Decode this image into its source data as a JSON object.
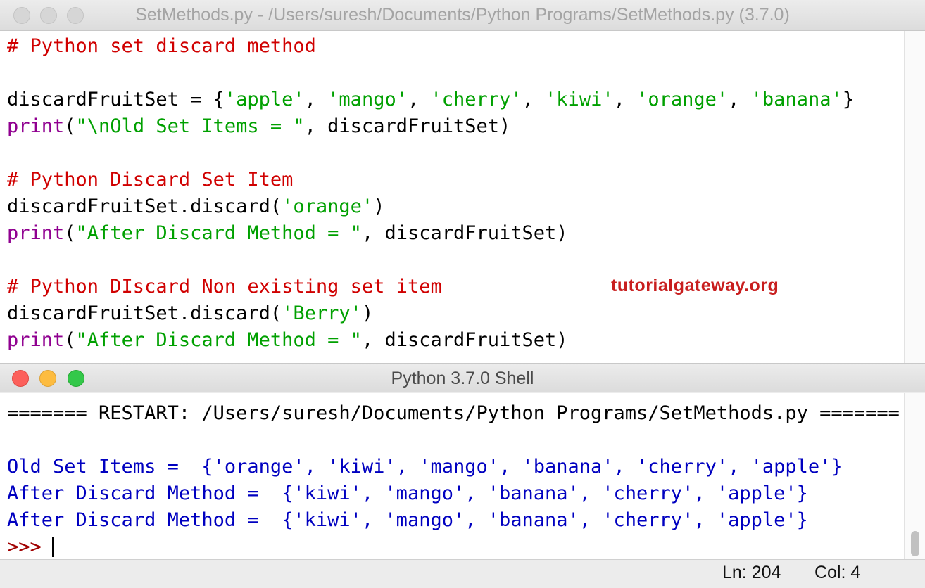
{
  "editor_window": {
    "title": "SetMethods.py - /Users/suresh/Documents/Python Programs/SetMethods.py (3.7.0)",
    "code_lines": [
      [
        {
          "t": "# Python set discard method",
          "c": "comment"
        }
      ],
      [],
      [
        {
          "t": "discardFruitSet = {",
          "c": "plain"
        },
        {
          "t": "'apple'",
          "c": "string"
        },
        {
          "t": ", ",
          "c": "plain"
        },
        {
          "t": "'mango'",
          "c": "string"
        },
        {
          "t": ", ",
          "c": "plain"
        },
        {
          "t": "'cherry'",
          "c": "string"
        },
        {
          "t": ", ",
          "c": "plain"
        },
        {
          "t": "'kiwi'",
          "c": "string"
        },
        {
          "t": ", ",
          "c": "plain"
        },
        {
          "t": "'orange'",
          "c": "string"
        },
        {
          "t": ", ",
          "c": "plain"
        },
        {
          "t": "'banana'",
          "c": "string"
        },
        {
          "t": "}",
          "c": "plain"
        }
      ],
      [
        {
          "t": "print",
          "c": "builtin"
        },
        {
          "t": "(",
          "c": "plain"
        },
        {
          "t": "\"\\nOld Set Items = \"",
          "c": "string"
        },
        {
          "t": ", discardFruitSet)",
          "c": "plain"
        }
      ],
      [],
      [
        {
          "t": "# Python Discard Set Item",
          "c": "comment"
        }
      ],
      [
        {
          "t": "discardFruitSet.discard(",
          "c": "plain"
        },
        {
          "t": "'orange'",
          "c": "string"
        },
        {
          "t": ")",
          "c": "plain"
        }
      ],
      [
        {
          "t": "print",
          "c": "builtin"
        },
        {
          "t": "(",
          "c": "plain"
        },
        {
          "t": "\"After Discard Method = \"",
          "c": "string"
        },
        {
          "t": ", discardFruitSet)",
          "c": "plain"
        }
      ],
      [],
      [
        {
          "t": "# Python DIscard Non existing set item",
          "c": "comment"
        }
      ],
      [
        {
          "t": "discardFruitSet.discard(",
          "c": "plain"
        },
        {
          "t": "'Berry'",
          "c": "string"
        },
        {
          "t": ")",
          "c": "plain"
        }
      ],
      [
        {
          "t": "print",
          "c": "builtin"
        },
        {
          "t": "(",
          "c": "plain"
        },
        {
          "t": "\"After Discard Method = \"",
          "c": "string"
        },
        {
          "t": ", discardFruitSet)",
          "c": "plain"
        }
      ]
    ],
    "watermark": "tutorialgateway.org"
  },
  "shell_window": {
    "title": "Python 3.7.0 Shell",
    "lines": [
      [
        {
          "t": "======= RESTART: /Users/suresh/Documents/Python Programs/SetMethods.py =======",
          "c": "plain"
        }
      ],
      [],
      [
        {
          "t": "Old Set Items =  {'orange', 'kiwi', 'mango', 'banana', 'cherry', 'apple'}",
          "c": "out"
        }
      ],
      [
        {
          "t": "After Discard Method =  {'kiwi', 'mango', 'banana', 'cherry', 'apple'}",
          "c": "out"
        }
      ],
      [
        {
          "t": "After Discard Method =  {'kiwi', 'mango', 'banana', 'cherry', 'apple'}",
          "c": "out"
        }
      ],
      [
        {
          "t": ">>> ",
          "c": "prompt"
        }
      ]
    ]
  },
  "status": {
    "ln": "Ln: 204",
    "col": "Col: 4"
  },
  "colors": {
    "comment": "#d00000",
    "builtin": "#900090",
    "string": "#00a000",
    "output": "#0000c0",
    "prompt": "#a00000",
    "watermark": "#c81e1e"
  }
}
